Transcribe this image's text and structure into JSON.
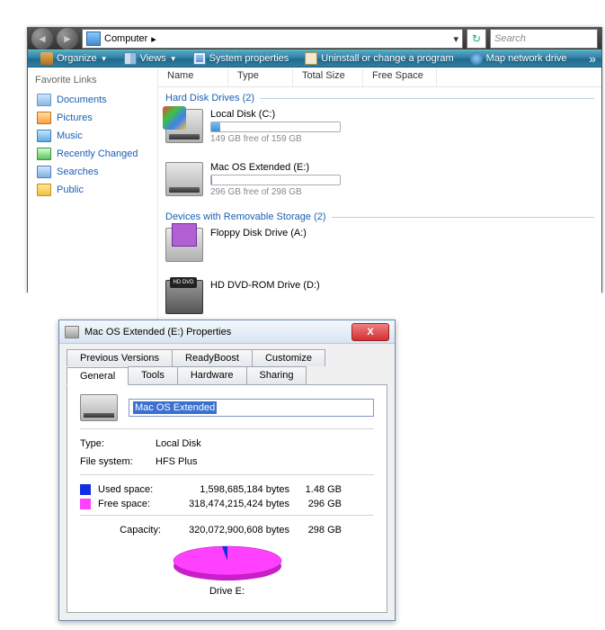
{
  "explorer": {
    "address": {
      "root": "Computer",
      "arrow": "▸"
    },
    "search_placeholder": "Search",
    "toolbar": {
      "organize": "Organize",
      "views": "Views",
      "system_properties": "System properties",
      "uninstall": "Uninstall or change a program",
      "map_drive": "Map network drive",
      "more": "»"
    },
    "sidebar": {
      "header": "Favorite Links",
      "items": [
        {
          "label": "Documents"
        },
        {
          "label": "Pictures"
        },
        {
          "label": "Music"
        },
        {
          "label": "Recently Changed"
        },
        {
          "label": "Searches"
        },
        {
          "label": "Public"
        }
      ]
    },
    "columns": {
      "name": "Name",
      "type": "Type",
      "total": "Total Size",
      "free": "Free Space"
    },
    "groups": {
      "hdd": {
        "header": "Hard Disk Drives (2)",
        "drives": [
          {
            "name": "Local Disk (C:)",
            "status": "149 GB free of 159 GB",
            "fill_pct": 7
          },
          {
            "name": "Mac OS Extended (E:)",
            "status": "296 GB free of 298 GB",
            "fill_pct": 1
          }
        ]
      },
      "removable": {
        "header": "Devices with Removable Storage (2)",
        "drives": [
          {
            "name": "Floppy Disk Drive (A:)"
          },
          {
            "name": "HD DVD-ROM Drive (D:)",
            "badge": "HD DVD"
          }
        ]
      }
    }
  },
  "props": {
    "title": "Mac OS Extended (E:) Properties",
    "tabs_row1": [
      "Previous Versions",
      "ReadyBoost",
      "Customize"
    ],
    "tabs_row2": [
      "General",
      "Tools",
      "Hardware",
      "Sharing"
    ],
    "name_value": "Mac OS Extended",
    "type_label": "Type:",
    "type_value": "Local Disk",
    "fs_label": "File system:",
    "fs_value": "HFS Plus",
    "used_label": "Used space:",
    "used_bytes": "1,598,685,184 bytes",
    "used_human": "1.48 GB",
    "free_label": "Free space:",
    "free_bytes": "318,474,215,424 bytes",
    "free_human": "296 GB",
    "capacity_label": "Capacity:",
    "capacity_bytes": "320,072,900,608 bytes",
    "capacity_human": "298 GB",
    "drive_label": "Drive E:"
  },
  "chart_data": {
    "type": "pie",
    "title": "Drive E:",
    "series": [
      {
        "name": "Used space",
        "value": 1598685184,
        "human": "1.48 GB",
        "color": "#1030e0"
      },
      {
        "name": "Free space",
        "value": 318474215424,
        "human": "296 GB",
        "color": "#ff40ff"
      }
    ],
    "total": {
      "value": 320072900608,
      "human": "298 GB"
    }
  }
}
